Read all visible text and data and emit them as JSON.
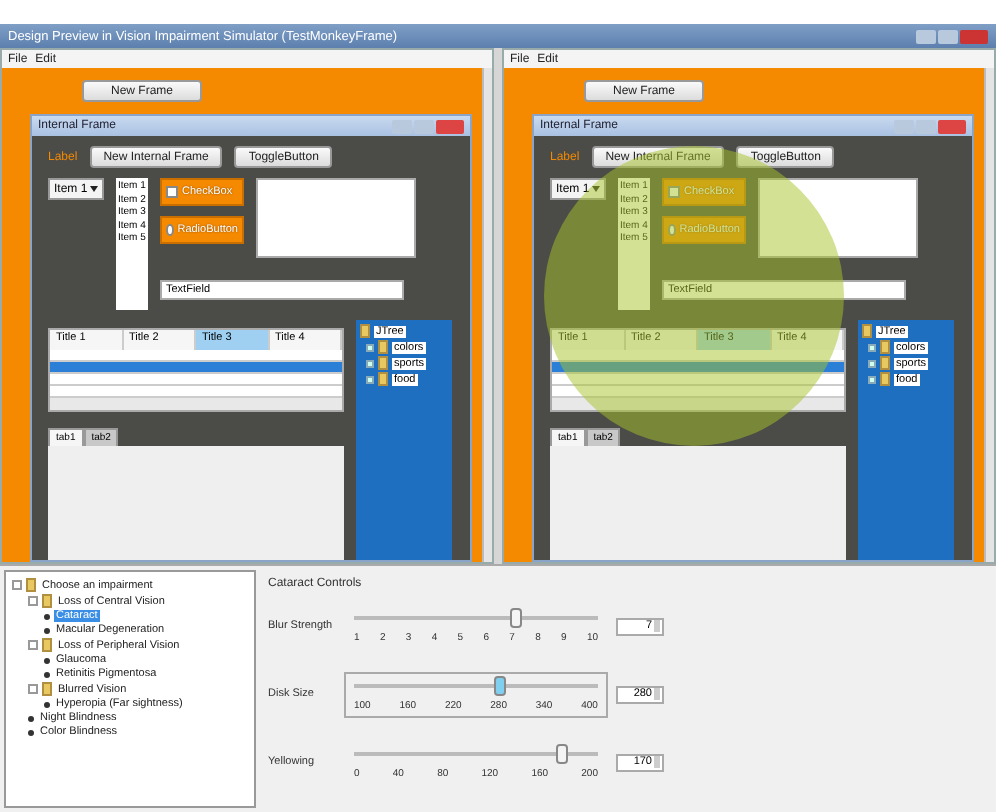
{
  "window": {
    "title": "Design Preview in Vision Impairment Simulator (TestMonkeyFrame)"
  },
  "panes": [
    {
      "menu": [
        "File",
        "Edit"
      ],
      "new_frame_button": "New Frame",
      "simulation_overlay": false,
      "internal_frame": {
        "title": "Internal Frame",
        "label": "Label",
        "buttons": [
          "New Internal Frame",
          "ToggleButton"
        ],
        "combo": "Item 1",
        "list": [
          "Item 1",
          "Item 2",
          "Item 3",
          "Item 4",
          "Item 5"
        ],
        "checkbox": {
          "label": "CheckBox",
          "checked": false
        },
        "radio": {
          "label": "RadioButton",
          "selected": false
        },
        "text_field": "TextField",
        "table": {
          "columns": [
            {
              "label": "Title 1",
              "selected": false
            },
            {
              "label": "Title 2",
              "selected": false
            },
            {
              "label": "Title 3",
              "selected": true
            },
            {
              "label": "Title 4",
              "selected": false
            }
          ],
          "rows": [
            {
              "selected": false
            },
            {
              "selected": true
            },
            {
              "selected": false
            },
            {
              "selected": false
            }
          ]
        },
        "tree": {
          "label": "JTree",
          "children": [
            {
              "label": "colors"
            },
            {
              "label": "sports"
            },
            {
              "label": "food"
            }
          ]
        },
        "tabs": [
          {
            "label": "tab1",
            "selected": true
          },
          {
            "label": "tab2",
            "selected": false
          }
        ]
      }
    },
    {
      "menu": [
        "File",
        "Edit"
      ],
      "new_frame_button": "New Frame",
      "simulation_overlay": true,
      "internal_frame": {
        "title": "Internal Frame",
        "label": "Label",
        "buttons": [
          "New Internal Frame",
          "ToggleButton"
        ],
        "combo": "Item 1",
        "list": [
          "Item 1",
          "Item 2",
          "Item 3",
          "Item 4",
          "Item 5"
        ],
        "checkbox": {
          "label": "CheckBox",
          "checked": false
        },
        "radio": {
          "label": "RadioButton",
          "selected": false
        },
        "text_field": "TextField",
        "table": {
          "columns": [
            {
              "label": "Title 1",
              "selected": false
            },
            {
              "label": "Title 2",
              "selected": false
            },
            {
              "label": "Title 3",
              "selected": true
            },
            {
              "label": "Title 4",
              "selected": false
            }
          ],
          "rows": [
            {
              "selected": false
            },
            {
              "selected": true
            },
            {
              "selected": false
            },
            {
              "selected": false
            }
          ]
        },
        "tree": {
          "label": "JTree",
          "children": [
            {
              "label": "colors"
            },
            {
              "label": "sports"
            },
            {
              "label": "food"
            }
          ]
        },
        "tabs": [
          {
            "label": "tab1",
            "selected": true
          },
          {
            "label": "tab2",
            "selected": false
          }
        ]
      }
    }
  ],
  "impairment_tree": {
    "label": "Choose an impairment",
    "expanded": true,
    "selected": false,
    "children": [
      {
        "label": "Loss of Central Vision",
        "expanded": true,
        "selected": false,
        "children": [
          {
            "label": "Cataract",
            "selected": true
          },
          {
            "label": "Macular Degeneration",
            "selected": false
          }
        ]
      },
      {
        "label": "Loss of Peripheral Vision",
        "expanded": true,
        "selected": false,
        "children": [
          {
            "label": "Glaucoma",
            "selected": false
          },
          {
            "label": "Retinitis Pigmentosa",
            "selected": false
          }
        ]
      },
      {
        "label": "Blurred Vision",
        "expanded": true,
        "selected": false,
        "children": [
          {
            "label": "Hyperopia (Far sightness)",
            "selected": false
          }
        ]
      },
      {
        "label": "Night Blindness",
        "selected": false
      },
      {
        "label": "Color Blindness",
        "selected": false
      }
    ]
  },
  "controls": {
    "title": "Cataract Controls",
    "sliders": [
      {
        "label": "Blur Strength",
        "ticks": [
          "1",
          "2",
          "3",
          "4",
          "5",
          "6",
          "7",
          "8",
          "9",
          "10"
        ],
        "level": 0.66,
        "value": "7",
        "focused": false
      },
      {
        "label": "Disk Size",
        "ticks": [
          "100",
          "160",
          "220",
          "280",
          "340",
          "400"
        ],
        "level": 0.6,
        "value": "280",
        "focused": true
      },
      {
        "label": "Yellowing",
        "ticks": [
          "0",
          "40",
          "80",
          "120",
          "160",
          "200"
        ],
        "level": 0.85,
        "value": "170",
        "focused": false
      }
    ]
  }
}
